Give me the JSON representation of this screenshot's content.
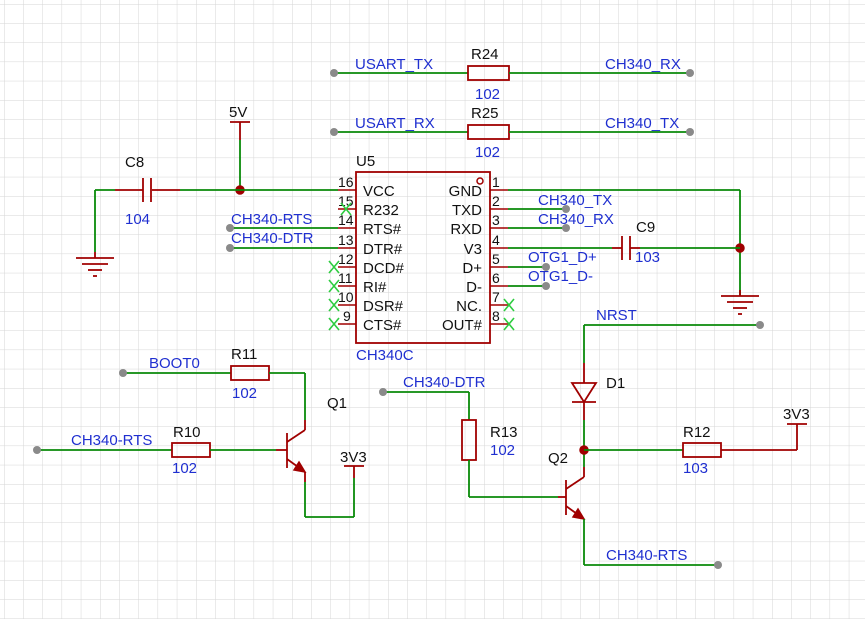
{
  "ic": {
    "ref": "U5",
    "part": "CH340C",
    "left_pins": [
      {
        "num": "16",
        "name": "VCC"
      },
      {
        "num": "15",
        "name": "R232"
      },
      {
        "num": "14",
        "name": "RTS#"
      },
      {
        "num": "13",
        "name": "DTR#"
      },
      {
        "num": "12",
        "name": "DCD#"
      },
      {
        "num": "11",
        "name": "RI#"
      },
      {
        "num": "10",
        "name": "DSR#"
      },
      {
        "num": "9",
        "name": "CTS#"
      }
    ],
    "right_pins": [
      {
        "num": "1",
        "name": "GND"
      },
      {
        "num": "2",
        "name": "TXD"
      },
      {
        "num": "3",
        "name": "RXD"
      },
      {
        "num": "4",
        "name": "V3"
      },
      {
        "num": "5",
        "name": "D+"
      },
      {
        "num": "6",
        "name": "D-"
      },
      {
        "num": "7",
        "name": "NC."
      },
      {
        "num": "8",
        "name": "OUT#"
      }
    ]
  },
  "resistors": {
    "r24": {
      "ref": "R24",
      "value": "102"
    },
    "r25": {
      "ref": "R25",
      "value": "102"
    },
    "r11": {
      "ref": "R11",
      "value": "102"
    },
    "r10": {
      "ref": "R10",
      "value": "102"
    },
    "r13": {
      "ref": "R13",
      "value": "102"
    },
    "r12": {
      "ref": "R12",
      "value": "103"
    }
  },
  "capacitors": {
    "c8": {
      "ref": "C8",
      "value": "104"
    },
    "c9": {
      "ref": "C9",
      "value": "103"
    }
  },
  "transistors": {
    "q1": "Q1",
    "q2": "Q2"
  },
  "diode": {
    "ref": "D1"
  },
  "power": {
    "v5": "5V",
    "v3a": "3V3",
    "v3b": "3V3"
  },
  "nets": {
    "usart_tx": "USART_TX",
    "ch340_rx_top": "CH340_RX",
    "usart_rx": "USART_RX",
    "ch340_tx_top": "CH340_TX",
    "ch340_tx_pin": "CH340_TX",
    "ch340_rx_pin": "CH340_RX",
    "otg_dp": "OTG1_D+",
    "otg_dm": "OTG1_D-",
    "rts_pin": "CH340-RTS",
    "dtr_pin": "CH340-DTR",
    "boot0": "BOOT0",
    "rts_q1": "CH340-RTS",
    "dtr_r13": "CH340-DTR",
    "nrst": "NRST",
    "rts_q2": "CH340-RTS"
  }
}
